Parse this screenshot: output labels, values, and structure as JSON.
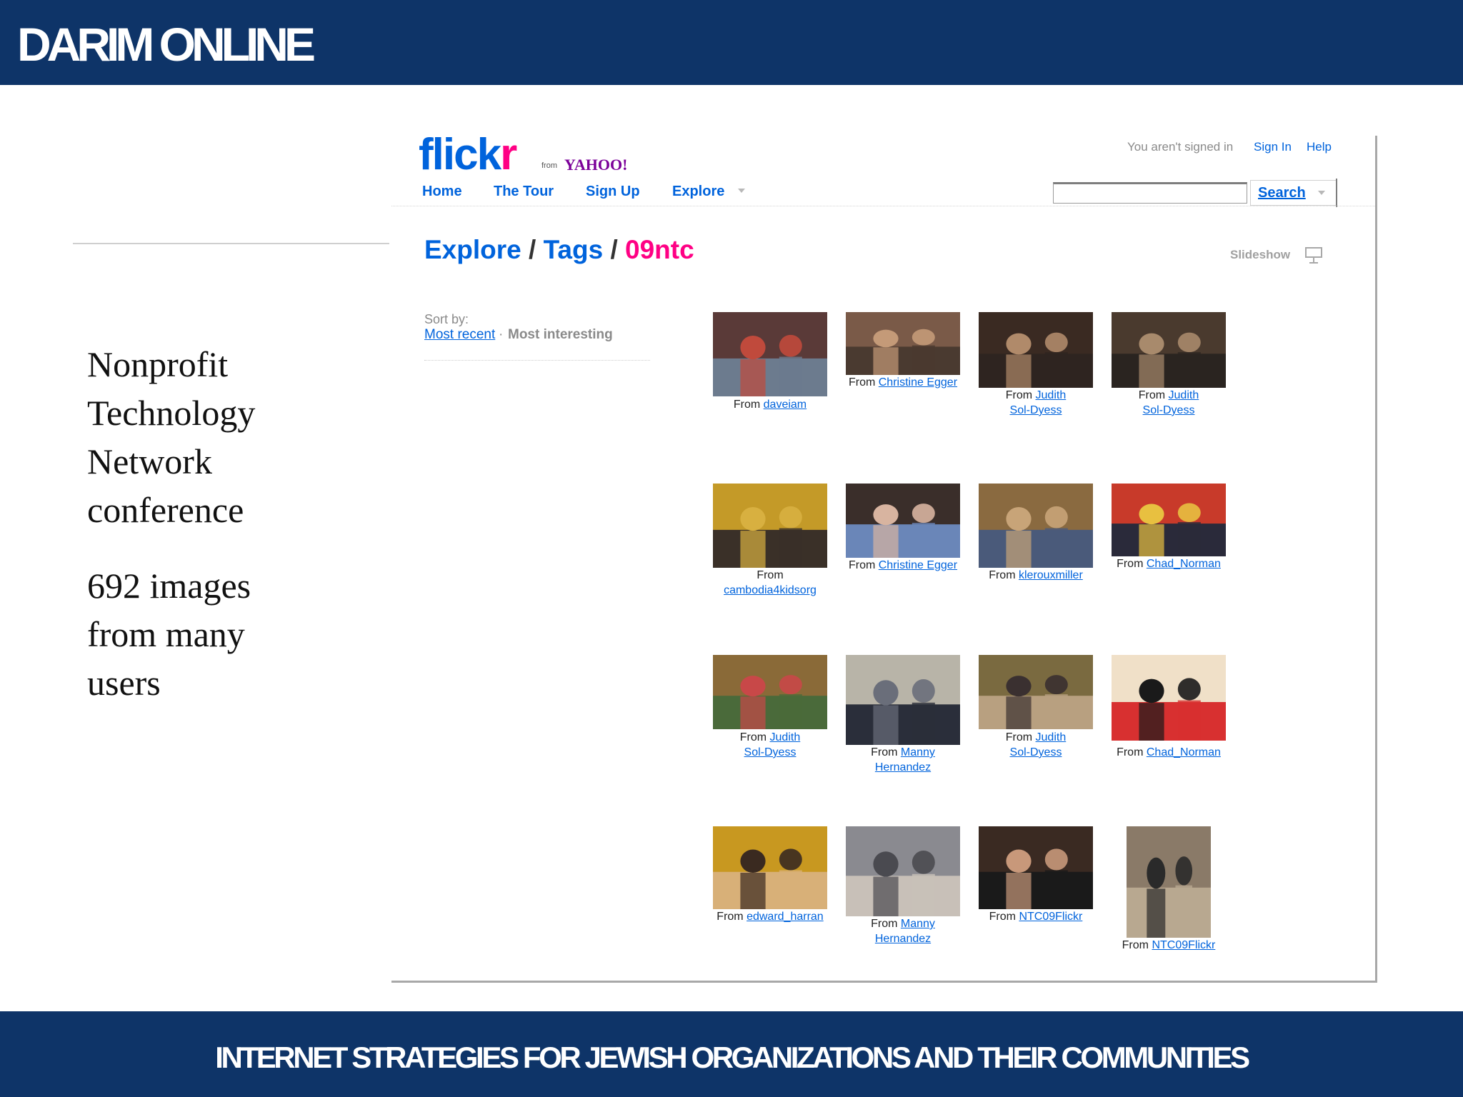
{
  "slide": {
    "brand": "DARIM ONLINE",
    "tagline": "INTERNET STRATEGIES FOR JEWISH ORGANIZATIONS AND THEIR COMMUNITIES",
    "side_text_1": "Nonprofit Technology Network conference",
    "side_text_2": "692 images from many users"
  },
  "flickr": {
    "logo_text": "flick",
    "logo_r": "r",
    "logo_from": "from",
    "logo_yahoo": "YAHOO!",
    "signed_text": "You aren't signed in",
    "sign_in": "Sign In",
    "help": "Help",
    "nav": {
      "home": "Home",
      "tour": "The Tour",
      "signup": "Sign Up",
      "explore": "Explore"
    },
    "search": {
      "value": "",
      "button": "Search"
    },
    "breadcrumb": {
      "explore": "Explore",
      "tags": "Tags",
      "sep": " / ",
      "current": "09ntc"
    },
    "slideshow": "Slideshow",
    "sort": {
      "label": "Sort by:",
      "recent": "Most recent",
      "dot": "·",
      "interesting": "Most interesting"
    },
    "from_label": "From",
    "photos": [
      {
        "user": "daveiam",
        "colors": [
          "#5a3a38",
          "#c04a3c",
          "#6c7b8e"
        ]
      },
      {
        "user": "Christine Egger",
        "colors": [
          "#7a5a48",
          "#c49a78",
          "#4a3a30"
        ]
      },
      {
        "user": "Judith Sol-Dyess",
        "colors": [
          "#3a2a22",
          "#b08a6a",
          "#2e2420"
        ]
      },
      {
        "user": "Judith Sol-Dyess",
        "colors": [
          "#4a3a2e",
          "#a88a6c",
          "#2a2420"
        ]
      },
      {
        "user": "cambodia4kidsorg",
        "colors": [
          "#c49a28",
          "#d8b040",
          "#3a3028"
        ]
      },
      {
        "user": "Christine Egger",
        "colors": [
          "#3a2e2a",
          "#d8b4a0",
          "#6a86b8"
        ]
      },
      {
        "user": "klerouxmiller",
        "colors": [
          "#8a6a40",
          "#c8a478",
          "#4a5a7a"
        ]
      },
      {
        "user": "Chad_Norman",
        "colors": [
          "#c83a2a",
          "#e8c040",
          "#2a2a3a"
        ]
      },
      {
        "user": "Judith Sol-Dyess",
        "colors": [
          "#8a6a38",
          "#c84848",
          "#4a6a3a"
        ]
      },
      {
        "user": "Manny Hernandez",
        "colors": [
          "#b8b4a8",
          "#6a6e7a",
          "#2a2e3a"
        ]
      },
      {
        "user": "Judith Sol-Dyess",
        "colors": [
          "#7a6a40",
          "#3a3030",
          "#b8a080"
        ]
      },
      {
        "user": "Chad_Norman",
        "colors": [
          "#f0e0c8",
          "#1a1a1a",
          "#d83030"
        ]
      },
      {
        "user": "edward_harran",
        "colors": [
          "#c89820",
          "#3a2a20",
          "#d8b078"
        ]
      },
      {
        "user": "Manny Hernandez",
        "colors": [
          "#8a8a90",
          "#4a4a50",
          "#c8c0b8"
        ]
      },
      {
        "user": "NTC09Flickr",
        "colors": [
          "#3a2a22",
          "#c8987a",
          "#1a1a1a"
        ]
      },
      {
        "user": "NTC09Flickr",
        "colors": [
          "#8a7a68",
          "#2a2a2a",
          "#b8a890"
        ]
      }
    ]
  }
}
